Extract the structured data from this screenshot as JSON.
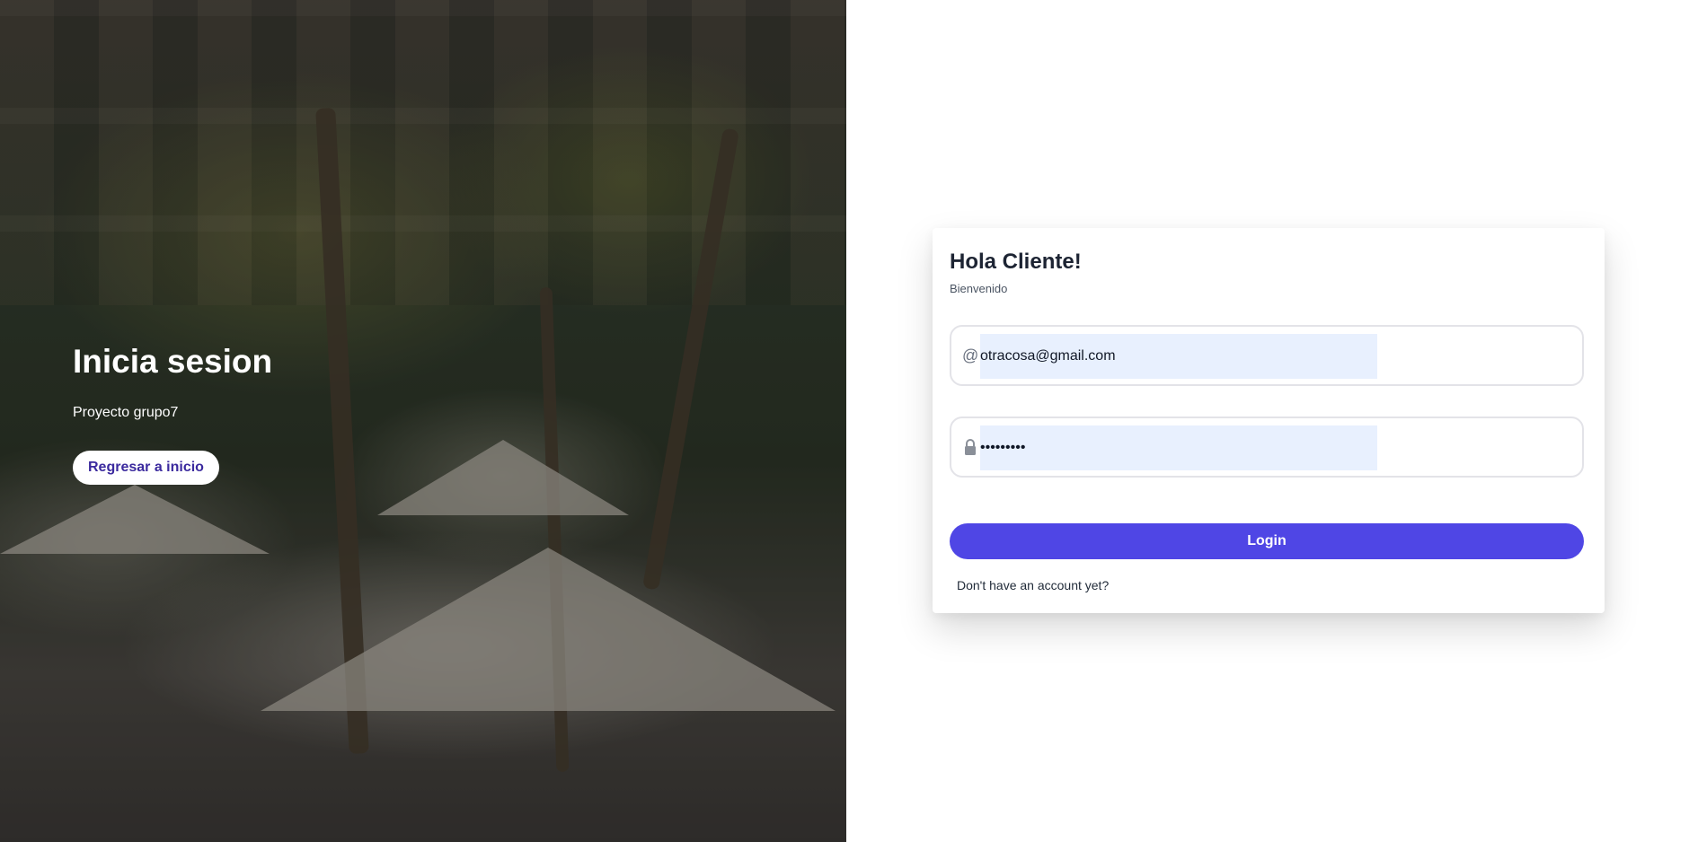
{
  "hero": {
    "title": "Inicia sesion",
    "subtitle": "Proyecto grupo7",
    "back_button": "Regresar a inicio"
  },
  "login": {
    "title": "Hola Cliente!",
    "subtitle": "Bienvenido",
    "email": {
      "icon": "at-icon",
      "icon_glyph": "@",
      "value": "otracosa@gmail.com"
    },
    "password": {
      "icon": "lock-icon",
      "value": "•••••••••"
    },
    "login_button": "Login",
    "signup_link": "Don't have an account yet?"
  },
  "colors": {
    "accent": "#4f46e5",
    "hero_button_text": "#3b2a9e",
    "autofill_bg": "#e8f0fe",
    "title_text": "#1d2433"
  }
}
